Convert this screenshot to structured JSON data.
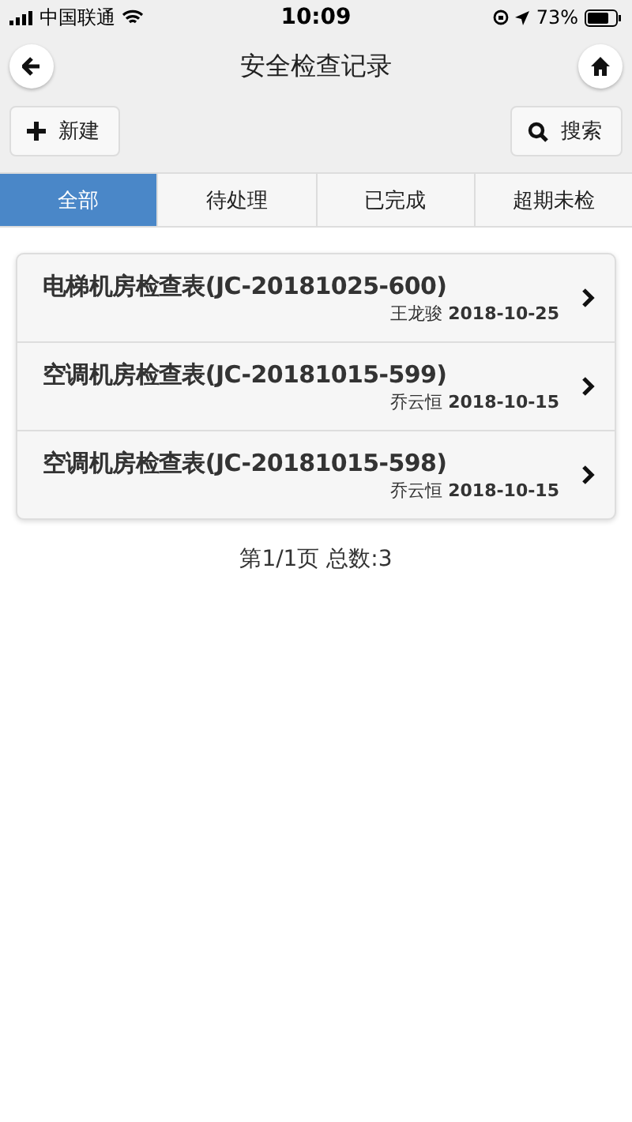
{
  "status_bar": {
    "carrier": "中国联通",
    "time": "10:09",
    "battery": "73%"
  },
  "nav": {
    "title": "安全检查记录"
  },
  "toolbar": {
    "new_label": "新建",
    "search_label": "搜索"
  },
  "tabs": [
    {
      "label": "全部",
      "selected": true
    },
    {
      "label": "待处理",
      "selected": false
    },
    {
      "label": "已完成",
      "selected": false
    },
    {
      "label": "超期未检",
      "selected": false
    }
  ],
  "records": [
    {
      "title": "电梯机房检查表(JC-20181025-600)",
      "person": "王龙骏",
      "date": "2018-10-25"
    },
    {
      "title": "空调机房检查表(JC-20181015-599)",
      "person": "乔云恒",
      "date": "2018-10-15"
    },
    {
      "title": "空调机房检查表(JC-20181015-598)",
      "person": "乔云恒",
      "date": "2018-10-15"
    }
  ],
  "pagination": "第1/1页 总数:3"
}
